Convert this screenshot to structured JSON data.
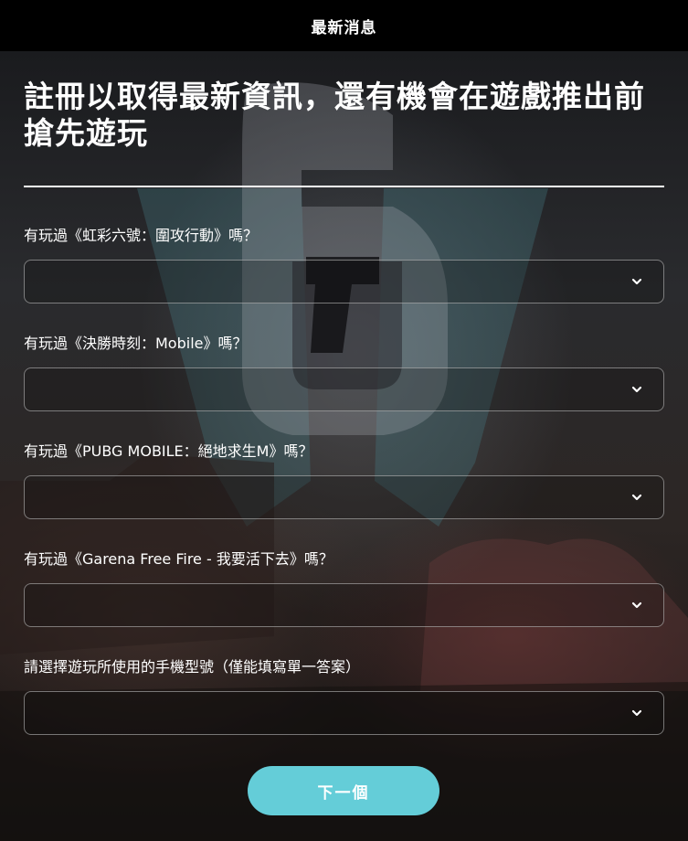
{
  "header": {
    "title": "最新消息"
  },
  "headline": {
    "text": "註冊以取得最新資訊，還有機會在遊戲推出前搶先遊玩"
  },
  "questions": [
    {
      "label": "有玩過《虹彩六號：圍攻行動》嗎？",
      "value": ""
    },
    {
      "label": "有玩過《決勝時刻：Mobile》嗎？",
      "value": ""
    },
    {
      "label": "有玩過《PUBG MOBILE：絕地求生M》嗎？",
      "value": ""
    },
    {
      "label": "有玩過《Garena Free Fire - 我要活下去》嗎？",
      "value": ""
    },
    {
      "label": "請選擇遊玩所使用的手機型號（僅能填寫單一答案）",
      "value": ""
    }
  ],
  "next_button": {
    "label": "下一個"
  },
  "colors": {
    "accent": "#64cdd8",
    "header_bg": "#000000",
    "text": "#ffffff"
  },
  "icons": {
    "select_chevron": "chevron-down-icon",
    "background_logo": "rainbow-six-logo"
  }
}
